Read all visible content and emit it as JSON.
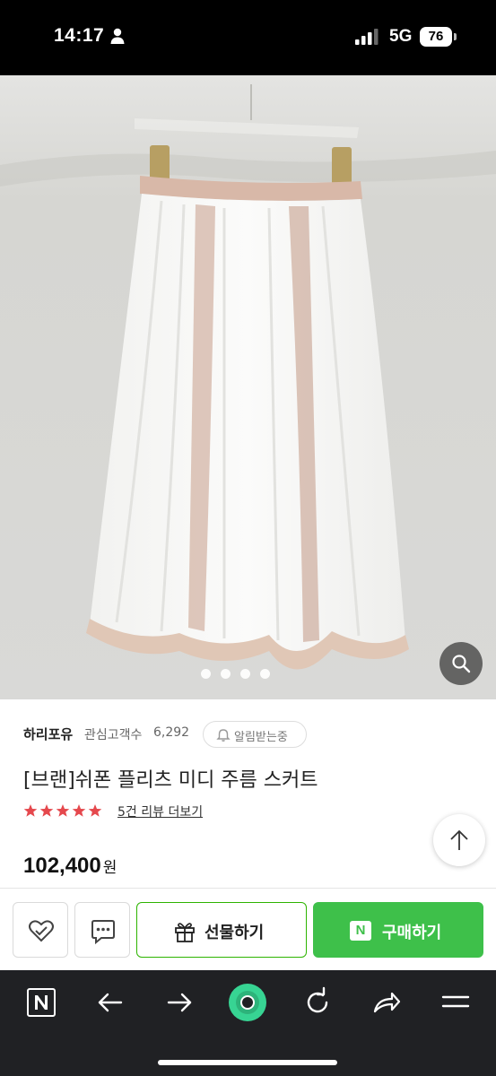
{
  "status_bar": {
    "time": "14:17",
    "network": "5G",
    "battery": "76"
  },
  "gallery": {
    "dot_count": 4,
    "zoom_icon": "search-icon"
  },
  "product": {
    "store_name": "하리포유",
    "interest_label": "관심고객수",
    "interest_count": "6,292",
    "alarm_label": "알림받는중",
    "title": "[브랜]쉬폰 플리츠 미디 주름 스커트",
    "rating_stars": 5,
    "review_link": "5건 리뷰 더보기",
    "price": "102,400",
    "price_unit": "원"
  },
  "actions": {
    "gift_label": "선물하기",
    "buy_label": "구매하기",
    "naver_mark": "N"
  },
  "toolbar": {
    "items": [
      "naver-home-icon",
      "back-arrow-icon",
      "forward-arrow-icon",
      "green-dot-icon",
      "refresh-icon",
      "share-icon",
      "menu-icon"
    ]
  },
  "colors": {
    "accent_green": "#3ec04a",
    "star_red": "#e5484d",
    "toolbar_bg": "#202124"
  }
}
